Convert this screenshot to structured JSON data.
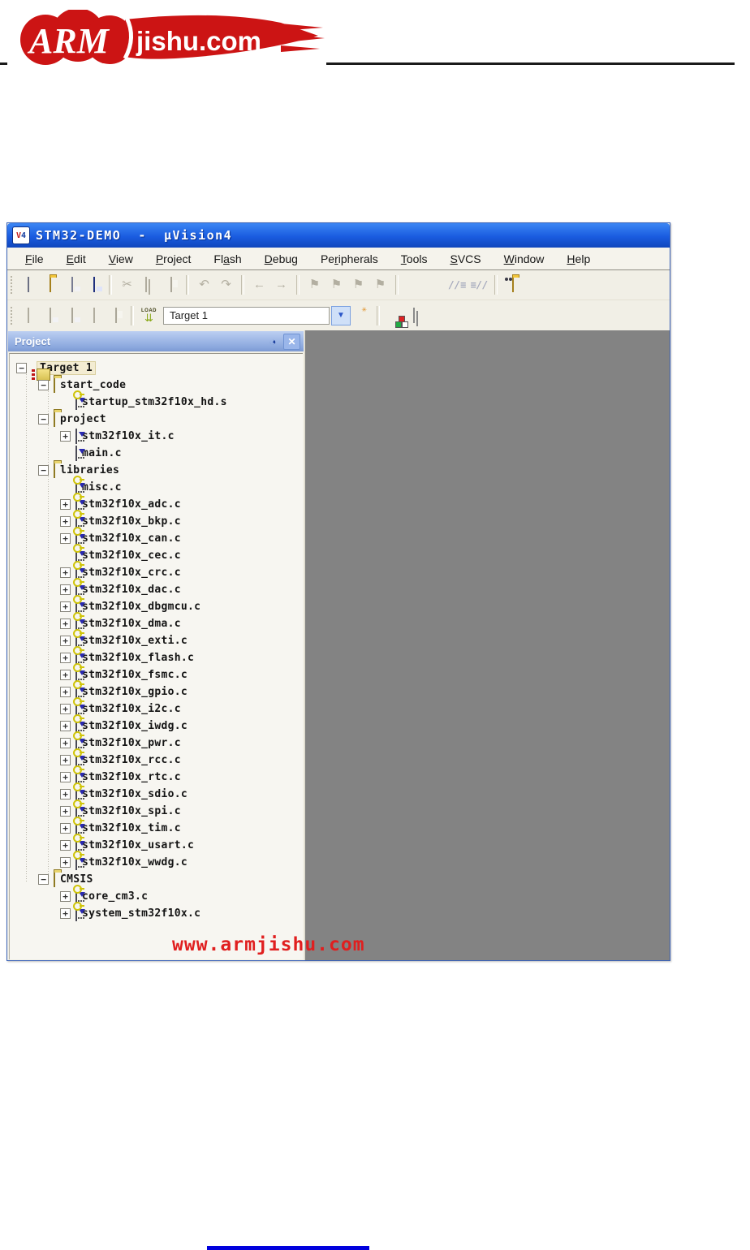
{
  "logo": {
    "arm": "ARM",
    "site": "jishu.com",
    "brand_color": "#cc1414"
  },
  "page": {
    "watermark": "www.armjishu.com"
  },
  "window": {
    "title": "STM32-DEMO  -  µVision4",
    "title_icon": {
      "v": "V",
      "num": "4"
    },
    "menu": [
      {
        "label": "File",
        "u": 0
      },
      {
        "label": "Edit",
        "u": 0
      },
      {
        "label": "View",
        "u": 0
      },
      {
        "label": "Project",
        "u": 0
      },
      {
        "label": "Flash",
        "u": 2
      },
      {
        "label": "Debug",
        "u": 0
      },
      {
        "label": "Peripherals",
        "u": 2
      },
      {
        "label": "Tools",
        "u": 0
      },
      {
        "label": "SVCS",
        "u": 0
      },
      {
        "label": "Window",
        "u": 0
      },
      {
        "label": "Help",
        "u": 0
      }
    ],
    "toolbar_main": [
      {
        "name": "new-file-icon",
        "kind": "page",
        "disabled": false
      },
      {
        "name": "open-file-icon",
        "kind": "folder",
        "disabled": false
      },
      {
        "name": "save-icon",
        "kind": "floppy",
        "disabled": true
      },
      {
        "name": "save-all-icon",
        "kind": "floppy-blue",
        "disabled": false
      },
      {
        "name": "sep"
      },
      {
        "name": "cut-icon",
        "kind": "scissors",
        "disabled": true
      },
      {
        "name": "copy-icon",
        "kind": "copy",
        "disabled": true
      },
      {
        "name": "paste-icon",
        "kind": "paste",
        "disabled": true
      },
      {
        "name": "sep"
      },
      {
        "name": "undo-icon",
        "kind": "undo",
        "disabled": true
      },
      {
        "name": "redo-icon",
        "kind": "redo",
        "disabled": true
      },
      {
        "name": "sep"
      },
      {
        "name": "navigate-back-icon",
        "kind": "arrow-left",
        "disabled": true
      },
      {
        "name": "navigate-forward-icon",
        "kind": "arrow-right",
        "disabled": true
      },
      {
        "name": "sep"
      },
      {
        "name": "bookmark-toggle-icon",
        "kind": "flag",
        "disabled": true
      },
      {
        "name": "bookmark-prev-icon",
        "kind": "flag",
        "disabled": true
      },
      {
        "name": "bookmark-next-icon",
        "kind": "flag",
        "disabled": true
      },
      {
        "name": "bookmark-clear-icon",
        "kind": "flag",
        "disabled": true
      },
      {
        "name": "sep"
      },
      {
        "name": "indent-left-icon",
        "kind": "lines",
        "disabled": true
      },
      {
        "name": "indent-right-icon",
        "kind": "lines",
        "disabled": true
      },
      {
        "name": "comment-icon",
        "kind": "comment",
        "disabled": true
      },
      {
        "name": "uncomment-icon",
        "kind": "comment2",
        "disabled": true
      },
      {
        "name": "sep"
      },
      {
        "name": "find-in-files-icon",
        "kind": "folder-find",
        "disabled": false
      }
    ],
    "toolbar_build": {
      "left_items": [
        {
          "name": "translate-file-icon",
          "kind": "page-gray",
          "disabled": true
        },
        {
          "name": "build-icon",
          "kind": "floppy-gray",
          "disabled": true
        },
        {
          "name": "rebuild-icon",
          "kind": "floppy-gray",
          "disabled": true
        },
        {
          "name": "batch-build-icon",
          "kind": "page-gray",
          "disabled": true
        },
        {
          "name": "stop-build-icon",
          "kind": "paste",
          "disabled": true
        },
        {
          "name": "sep"
        },
        {
          "name": "download-flash-icon",
          "kind": "load",
          "disabled": false
        }
      ],
      "load_label": "LOAD",
      "load_arrows": "⇊",
      "target_combo_value": "Target 1",
      "combo_arrow": "▼",
      "right_items": [
        {
          "name": "target-options-icon",
          "kind": "wand",
          "disabled": false
        },
        {
          "name": "sep"
        },
        {
          "name": "manage-components-icon",
          "kind": "grid",
          "disabled": false
        },
        {
          "name": "multi-project-icon",
          "kind": "stack",
          "disabled": false
        }
      ]
    },
    "project_panel": {
      "title": "Project",
      "pin_glyph": "◔",
      "close_glyph": "✕"
    },
    "tree": [
      {
        "label": "Target 1",
        "level": 0,
        "expand": "minus",
        "icon": "target",
        "selected": true
      },
      {
        "label": "start_code",
        "level": 1,
        "expand": "minus",
        "icon": "folder"
      },
      {
        "label": "startup_stm32f10x_hd.s",
        "level": 2,
        "expand": "none",
        "icon": "file-key"
      },
      {
        "label": "project",
        "level": 1,
        "expand": "minus",
        "icon": "folder"
      },
      {
        "label": "stm32f10x_it.c",
        "level": 2,
        "expand": "plus",
        "icon": "file"
      },
      {
        "label": "main.c",
        "level": 2,
        "expand": "none",
        "icon": "file"
      },
      {
        "label": "libraries",
        "level": 1,
        "expand": "minus",
        "icon": "folder"
      },
      {
        "label": "misc.c",
        "level": 2,
        "expand": "none",
        "icon": "file-key"
      },
      {
        "label": "stm32f10x_adc.c",
        "level": 2,
        "expand": "plus",
        "icon": "file-key"
      },
      {
        "label": "stm32f10x_bkp.c",
        "level": 2,
        "expand": "plus",
        "icon": "file-key"
      },
      {
        "label": "stm32f10x_can.c",
        "level": 2,
        "expand": "plus",
        "icon": "file-key"
      },
      {
        "label": "stm32f10x_cec.c",
        "level": 2,
        "expand": "none",
        "icon": "file-key"
      },
      {
        "label": "stm32f10x_crc.c",
        "level": 2,
        "expand": "plus",
        "icon": "file-key"
      },
      {
        "label": "stm32f10x_dac.c",
        "level": 2,
        "expand": "plus",
        "icon": "file-key"
      },
      {
        "label": "stm32f10x_dbgmcu.c",
        "level": 2,
        "expand": "plus",
        "icon": "file-key"
      },
      {
        "label": "stm32f10x_dma.c",
        "level": 2,
        "expand": "plus",
        "icon": "file-key"
      },
      {
        "label": "stm32f10x_exti.c",
        "level": 2,
        "expand": "plus",
        "icon": "file-key"
      },
      {
        "label": "stm32f10x_flash.c",
        "level": 2,
        "expand": "plus",
        "icon": "file-key"
      },
      {
        "label": "stm32f10x_fsmc.c",
        "level": 2,
        "expand": "plus",
        "icon": "file-key"
      },
      {
        "label": "stm32f10x_gpio.c",
        "level": 2,
        "expand": "plus",
        "icon": "file-key"
      },
      {
        "label": "stm32f10x_i2c.c",
        "level": 2,
        "expand": "plus",
        "icon": "file-key"
      },
      {
        "label": "stm32f10x_iwdg.c",
        "level": 2,
        "expand": "plus",
        "icon": "file-key"
      },
      {
        "label": "stm32f10x_pwr.c",
        "level": 2,
        "expand": "plus",
        "icon": "file-key"
      },
      {
        "label": "stm32f10x_rcc.c",
        "level": 2,
        "expand": "plus",
        "icon": "file-key"
      },
      {
        "label": "stm32f10x_rtc.c",
        "level": 2,
        "expand": "plus",
        "icon": "file-key"
      },
      {
        "label": "stm32f10x_sdio.c",
        "level": 2,
        "expand": "plus",
        "icon": "file-key"
      },
      {
        "label": "stm32f10x_spi.c",
        "level": 2,
        "expand": "plus",
        "icon": "file-key"
      },
      {
        "label": "stm32f10x_tim.c",
        "level": 2,
        "expand": "plus",
        "icon": "file-key"
      },
      {
        "label": "stm32f10x_usart.c",
        "level": 2,
        "expand": "plus",
        "icon": "file-key"
      },
      {
        "label": "stm32f10x_wwdg.c",
        "level": 2,
        "expand": "plus",
        "icon": "file-key"
      },
      {
        "label": "CMSIS",
        "level": 1,
        "expand": "minus",
        "icon": "folder"
      },
      {
        "label": "core_cm3.c",
        "level": 2,
        "expand": "plus",
        "icon": "file-key"
      },
      {
        "label": "system_stm32f10x.c",
        "level": 2,
        "expand": "plus",
        "icon": "file-key"
      }
    ]
  }
}
